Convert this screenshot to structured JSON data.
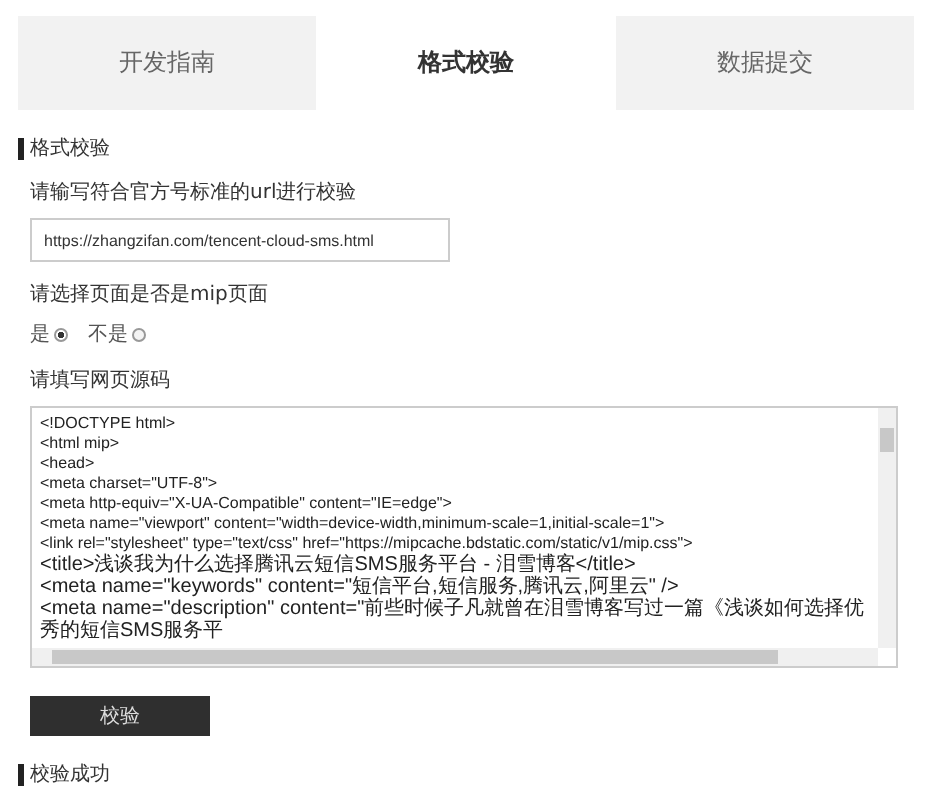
{
  "tabs": [
    {
      "label": "开发指南",
      "selected": false
    },
    {
      "label": "格式校验",
      "selected": true
    },
    {
      "label": "数据提交",
      "selected": false
    }
  ],
  "section_title": "格式校验",
  "url_label": "请输写符合官方号标准的url进行校验",
  "url_value": "https://zhangzifan.com/tencent-cloud-sms.html",
  "mip_label": "请选择页面是否是mip页面",
  "mip_options": [
    {
      "label": "是",
      "selected": true
    },
    {
      "label": "不是",
      "selected": false
    }
  ],
  "source_label": "请填写网页源码",
  "source_lines": [
    "<!DOCTYPE html>",
    "<html mip>",
    "<head>",
    "<meta charset=\"UTF-8\">",
    "<meta http-equiv=\"X-UA-Compatible\" content=\"IE=edge\">",
    "<meta name=\"viewport\" content=\"width=device-width,minimum-scale=1,initial-scale=1\">",
    "<link rel=\"stylesheet\" type=\"text/css\" href=\"https://mipcache.bdstatic.com/static/v1/mip.css\">",
    "<title>浅谈我为什么选择腾讯云短信SMS服务平台 - 泪雪博客</title>",
    "<meta name=\"keywords\" content=\"短信平台,短信服务,腾讯云,阿里云\" />",
    "<meta name=\"description\" content=\"前些时候子凡就曾在泪雪博客写过一篇《浅谈如何选择优秀的短信SMS服务平"
  ],
  "submit_label": "校验",
  "result_title": "校验成功"
}
